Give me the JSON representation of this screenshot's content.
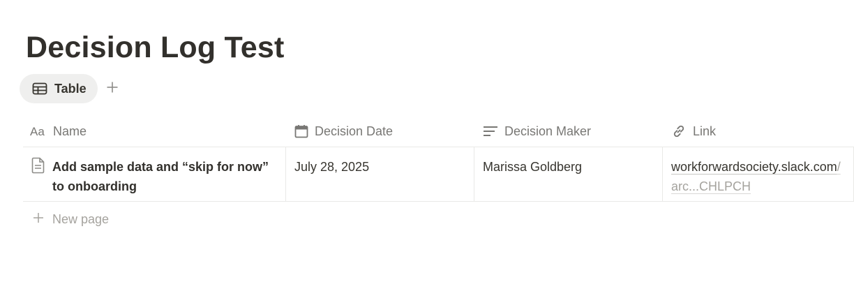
{
  "page": {
    "title": "Decision Log Test"
  },
  "views": {
    "active_tab": {
      "label": "Table",
      "icon": "table-icon"
    },
    "add_icon": "plus-icon"
  },
  "table": {
    "columns": [
      {
        "label": "Name",
        "icon": "text-property-icon"
      },
      {
        "label": "Decision Date",
        "icon": "calendar-icon"
      },
      {
        "label": "Decision Maker",
        "icon": "text-lines-icon"
      },
      {
        "label": "Link",
        "icon": "link-icon"
      }
    ],
    "rows": [
      {
        "name": "Add sample data and “skip for now” to onboarding",
        "name_icon": "page-icon",
        "decision_date": "July 28, 2025",
        "decision_maker": "Marissa Goldberg",
        "link_main": "workforwardsociety.slack.com",
        "link_tail": "/arc...CHLPCH"
      }
    ],
    "new_page_label": "New page"
  },
  "colors": {
    "text": "#37352f",
    "muted": "#787774",
    "faint": "#a5a39e",
    "border": "#e9e9e7",
    "tab_bg": "#efefee"
  }
}
